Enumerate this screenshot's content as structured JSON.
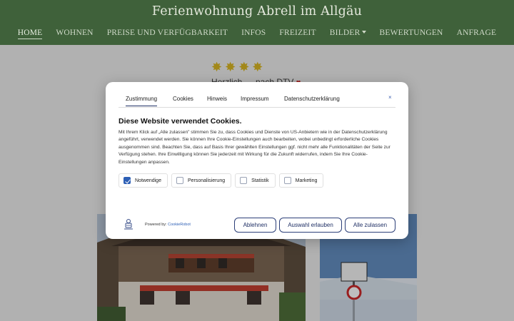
{
  "header": {
    "title": "Ferienwohnung Abrell im Allgäu",
    "nav": [
      {
        "label": "HOME",
        "active": true
      },
      {
        "label": "WOHNEN"
      },
      {
        "label": "PREISE UND VERFÜGBARKEIT"
      },
      {
        "label": "INFOS"
      },
      {
        "label": "FREIZEIT"
      },
      {
        "label": "BILDER",
        "has_dropdown": true
      },
      {
        "label": "BEWERTUNGEN"
      },
      {
        "label": "ANFRAGE"
      }
    ]
  },
  "rating": {
    "stars": 4,
    "text": "Herzlich … nach DTV"
  },
  "cookie_dialog": {
    "tabs": [
      "Zustimmung",
      "Cookies",
      "Hinweis",
      "Impressum",
      "Datenschutzerklärung"
    ],
    "close_label": "×",
    "heading": "Diese Website verwendet Cookies.",
    "body": "Mit Ihrem Klick auf „Alle zulassen\" stimmen Sie zu, dass Cookies und Dienste von US-Anbietern wie in der Datenschutzerklärung angeführt, verwendet werden. Sie können Ihre Cookie-Einstellungen auch bearbeiten, wobei unbedingt erforderliche Cookies ausgenommen sind. Beachten Sie, dass auf Basis Ihrer gewählten Einstellungen ggf. nicht mehr alle Funktionalitäten der Seite zur Verfügung stehen. Ihre Einwilligung können Sie jederzeit mit Wirkung für die Zukunft widerrufen, indem Sie Ihre Cookie-Einstellungen anpassen.",
    "options": [
      {
        "label": "Notwendige",
        "checked": true
      },
      {
        "label": "Personalisierung",
        "checked": false
      },
      {
        "label": "Statistik",
        "checked": false
      },
      {
        "label": "Marketing",
        "checked": false
      }
    ],
    "powered_prefix": "Powered by:",
    "powered_link": "CookieRobot",
    "buttons": {
      "deny": "Ablehnen",
      "select": "Auswahl erlauben",
      "allow": "Alle zulassen"
    }
  },
  "colors": {
    "header_bg": "#3f613a",
    "star": "#d8b41c",
    "button_border": "#2c3f78",
    "checkbox_checked": "#2d5fb5"
  }
}
